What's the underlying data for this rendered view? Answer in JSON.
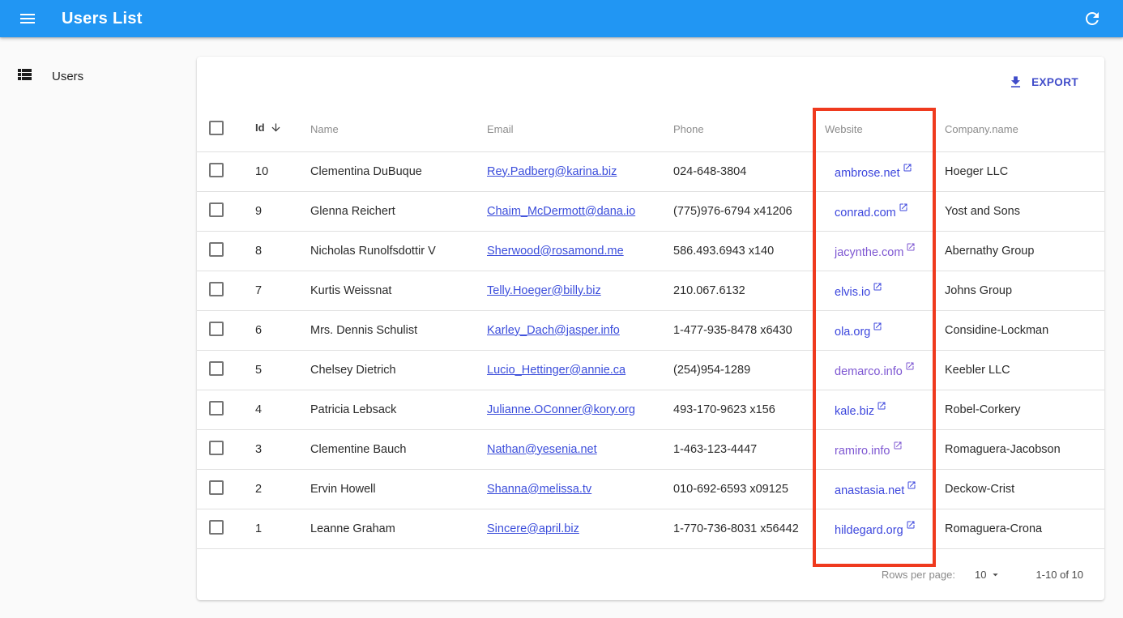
{
  "app_bar": {
    "title": "Users List"
  },
  "sidebar": {
    "items": [
      {
        "label": "Users",
        "icon": "view-list-icon"
      }
    ]
  },
  "toolbar": {
    "export_label": "EXPORT",
    "export_icon": "download-icon"
  },
  "table": {
    "columns": [
      {
        "label": "Id",
        "sorted": "desc"
      },
      {
        "label": "Name"
      },
      {
        "label": "Email"
      },
      {
        "label": "Phone"
      },
      {
        "label": "Website"
      },
      {
        "label": "Company.name"
      }
    ],
    "rows": [
      {
        "id": "10",
        "name": "Clementina DuBuque",
        "email": "Rey.Padberg@karina.biz",
        "phone": "024-648-3804",
        "website": "ambrose.net",
        "website_visited": false,
        "company": "Hoeger LLC"
      },
      {
        "id": "9",
        "name": "Glenna Reichert",
        "email": "Chaim_McDermott@dana.io",
        "phone": "(775)976-6794 x41206",
        "website": "conrad.com",
        "website_visited": false,
        "company": "Yost and Sons"
      },
      {
        "id": "8",
        "name": "Nicholas Runolfsdottir V",
        "email": "Sherwood@rosamond.me",
        "phone": "586.493.6943 x140",
        "website": "jacynthe.com",
        "website_visited": true,
        "company": "Abernathy Group"
      },
      {
        "id": "7",
        "name": "Kurtis Weissnat",
        "email": "Telly.Hoeger@billy.biz",
        "phone": "210.067.6132",
        "website": "elvis.io",
        "website_visited": false,
        "company": "Johns Group"
      },
      {
        "id": "6",
        "name": "Mrs. Dennis Schulist",
        "email": "Karley_Dach@jasper.info",
        "phone": "1-477-935-8478 x6430",
        "website": "ola.org",
        "website_visited": false,
        "company": "Considine-Lockman"
      },
      {
        "id": "5",
        "name": "Chelsey Dietrich",
        "email": "Lucio_Hettinger@annie.ca",
        "phone": "(254)954-1289",
        "website": "demarco.info",
        "website_visited": true,
        "company": "Keebler LLC"
      },
      {
        "id": "4",
        "name": "Patricia Lebsack",
        "email": "Julianne.OConner@kory.org",
        "phone": "493-170-9623 x156",
        "website": "kale.biz",
        "website_visited": false,
        "company": "Robel-Corkery"
      },
      {
        "id": "3",
        "name": "Clementine Bauch",
        "email": "Nathan@yesenia.net",
        "phone": "1-463-123-4447",
        "website": "ramiro.info",
        "website_visited": true,
        "company": "Romaguera-Jacobson"
      },
      {
        "id": "2",
        "name": "Ervin Howell",
        "email": "Shanna@melissa.tv",
        "phone": "010-692-6593 x09125",
        "website": "anastasia.net",
        "website_visited": false,
        "company": "Deckow-Crist"
      },
      {
        "id": "1",
        "name": "Leanne Graham",
        "email": "Sincere@april.biz",
        "phone": "1-770-736-8031 x56442",
        "website": "hildegard.org",
        "website_visited": false,
        "company": "Romaguera-Crona"
      }
    ]
  },
  "pagination": {
    "rows_per_page_label": "Rows per page:",
    "rows_per_page_value": "10",
    "range_label": "1-10 of 10"
  },
  "annotation": {
    "highlighted_column": "Website",
    "color": "#ef3a1e"
  },
  "colors": {
    "appbar": "#2196f3",
    "link_blue": "#3b4ddb",
    "link_visited": "#7e57d2",
    "export": "#3f4bc9",
    "annotation_red": "#ef3a1e"
  }
}
